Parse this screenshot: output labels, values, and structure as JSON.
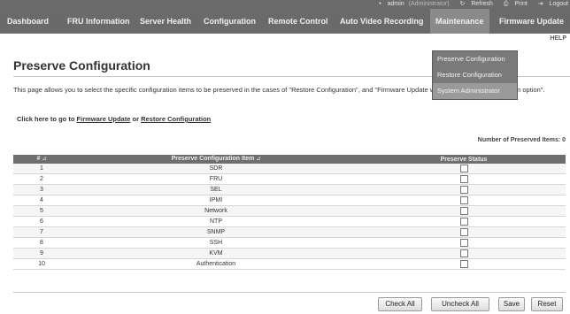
{
  "topbar": {
    "user": "admin",
    "role": "(Administrator)",
    "refresh": "Refresh",
    "print": "Print",
    "logout": "Logout"
  },
  "nav": {
    "dashboard": "Dashboard",
    "fru": "FRU Information",
    "health": "Server Health",
    "config": "Configuration",
    "remote": "Remote Control",
    "avr": "Auto Video Recording",
    "maintenance": "Maintenance",
    "firmware": "Firmware Update",
    "help": "HELP"
  },
  "dropdown": {
    "items": [
      "Preserve Configuration",
      "Restore Configuration",
      "System Administrator"
    ]
  },
  "page": {
    "title": "Preserve Configuration",
    "description": "This page allows you to select the specific configuration items to be preserved in the cases of \"Restore Configuration\", and \"Firmware Update without Preserve Configuration option\".",
    "goto_prefix": "Click here to go to",
    "goto_link1": "Firmware Update",
    "goto_or": "or",
    "goto_link2": "Restore Configuration",
    "count_label": "Number of Preserved Items: 0"
  },
  "table": {
    "headers": [
      "#",
      "Preserve Configuration Item",
      "Preserve Status"
    ],
    "rows": [
      {
        "num": "1",
        "item": "SDR"
      },
      {
        "num": "2",
        "item": "FRU"
      },
      {
        "num": "3",
        "item": "SEL"
      },
      {
        "num": "4",
        "item": "IPMI"
      },
      {
        "num": "5",
        "item": "Network"
      },
      {
        "num": "6",
        "item": "NTP"
      },
      {
        "num": "7",
        "item": "SNMP"
      },
      {
        "num": "8",
        "item": "SSH"
      },
      {
        "num": "9",
        "item": "KVM"
      },
      {
        "num": "10",
        "item": "Authentication"
      }
    ]
  },
  "buttons": {
    "check_all": "Check All",
    "uncheck_all": "Uncheck All",
    "save": "Save",
    "reset": "Reset"
  }
}
